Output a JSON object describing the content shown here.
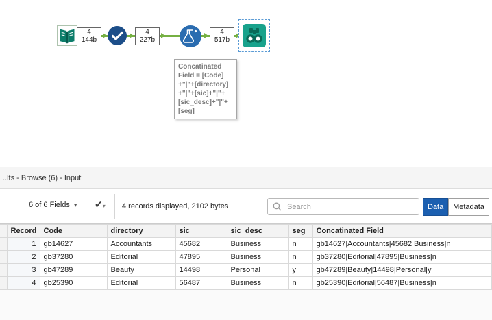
{
  "colors": {
    "connection_green": "#76b043",
    "browse_teal": "#18a28c",
    "select_navy": "#1c4e89",
    "formula_blue": "#2a6cb0",
    "input_teal": "#0c7d6a",
    "data_button_blue": "#1b5fb0"
  },
  "icons": {
    "caret_down": "▾",
    "apply_check": "✔"
  },
  "canvas": {
    "connections": [
      {
        "records": "4",
        "size": "144b"
      },
      {
        "records": "4",
        "size": "227b"
      },
      {
        "records": "4",
        "size": "517b"
      }
    ],
    "tooltip_text": "Concatinated\nField = [Code]\n+\"|\"+[directory]\n+\"|\"+[sic]+\"|\"+\n[sic_desc]+\"|\"+\n[seg]"
  },
  "results": {
    "title": "..lts - Browse (6) - Input",
    "fields_dropdown": "6 of 6 Fields",
    "records_info": "4 records displayed, 2102 bytes",
    "search_placeholder": "Search",
    "data_button": "Data",
    "metadata_button": "Metadata",
    "table": {
      "columns": [
        "Record",
        "Code",
        "directory",
        "sic",
        "sic_desc",
        "seg",
        "Concatinated Field"
      ],
      "rows": [
        [
          "1",
          "gb14627",
          "Accountants",
          "45682",
          "Business",
          "n",
          "gb14627|Accountants|45682|Business|n"
        ],
        [
          "2",
          "gb37280",
          "Editorial",
          "47895",
          "Business",
          "n",
          "gb37280|Editorial|47895|Business|n"
        ],
        [
          "3",
          "gb47289",
          "Beauty",
          "14498",
          "Personal",
          "y",
          "gb47289|Beauty|14498|Personal|y"
        ],
        [
          "4",
          "gb25390",
          "Editorial",
          "56487",
          "Business",
          "n",
          "gb25390|Editorial|56487|Business|n"
        ]
      ]
    }
  }
}
